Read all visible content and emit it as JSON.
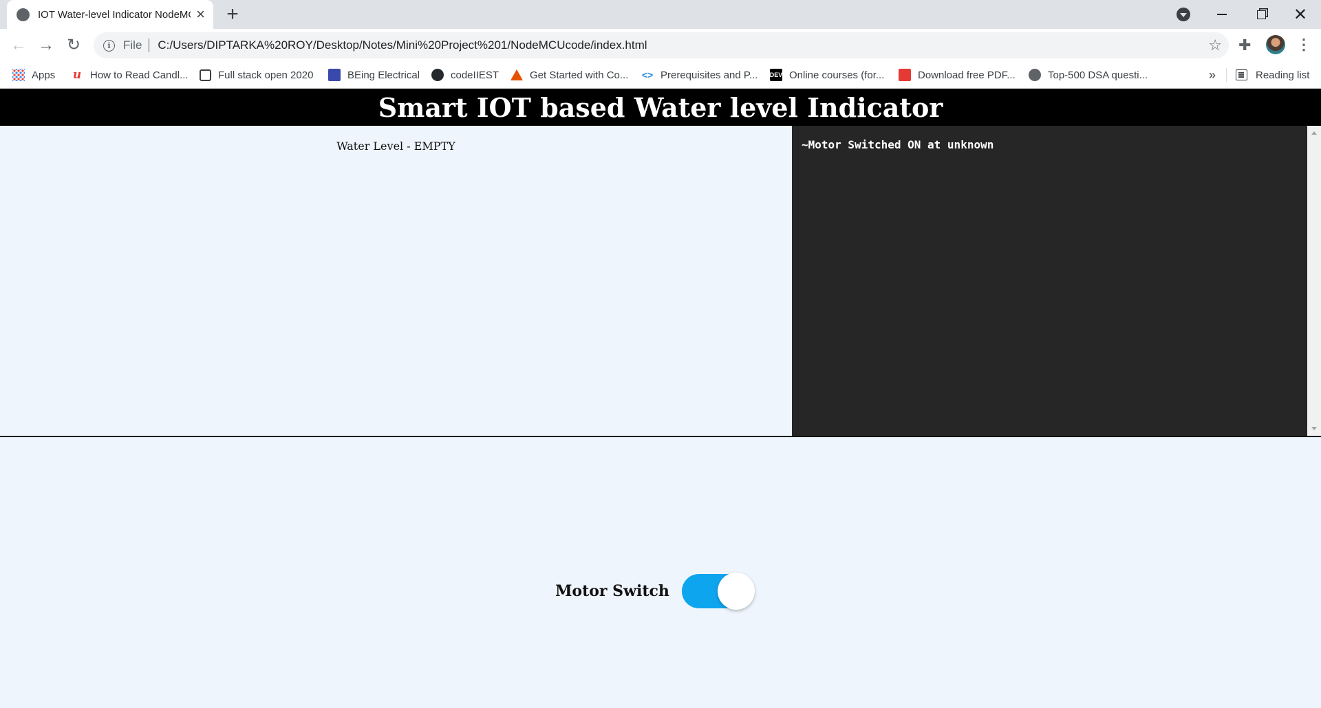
{
  "browser": {
    "tab": {
      "title": "IOT Water-level Indicator NodeMCU"
    },
    "address_bar": {
      "scheme_chip": "File",
      "url": "C:/Users/DIPTARKA%20ROY/Desktop/Notes/Mini%20Project%201/NodeMCUcode/index.html"
    },
    "bookmarks": [
      {
        "label": "Apps",
        "icon": "apps-grid-icon"
      },
      {
        "label": "How to Read Candl...",
        "icon": "udemy-icon"
      },
      {
        "label": "Full stack open 2020",
        "icon": "square-icon"
      },
      {
        "label": "BEing Electrical",
        "icon": "site-icon"
      },
      {
        "label": "codeIIEST",
        "icon": "github-icon"
      },
      {
        "label": "Get Started with Co...",
        "icon": "matlab-icon"
      },
      {
        "label": "Prerequisites and P...",
        "icon": "code-icon"
      },
      {
        "label": "Online courses (for...",
        "icon": "dev-icon"
      },
      {
        "label": "Download free PDF...",
        "icon": "pdf-icon"
      },
      {
        "label": "Top-500 DSA questi...",
        "icon": "globe-icon"
      }
    ],
    "bookmarks_overflow": "»",
    "reading_list": "Reading list"
  },
  "page": {
    "header_title": "Smart IOT based Water level Indicator",
    "water_level_text": "Water Level - EMPTY",
    "log_entries": [
      "~Motor Switched ON at unknown"
    ],
    "motor_switch": {
      "label": "Motor Switch",
      "state": "on"
    }
  },
  "colors": {
    "header_bg": "#000000",
    "page_bg": "#eef5fc",
    "log_bg": "#262626",
    "toggle_on": "#0ea5ef"
  }
}
